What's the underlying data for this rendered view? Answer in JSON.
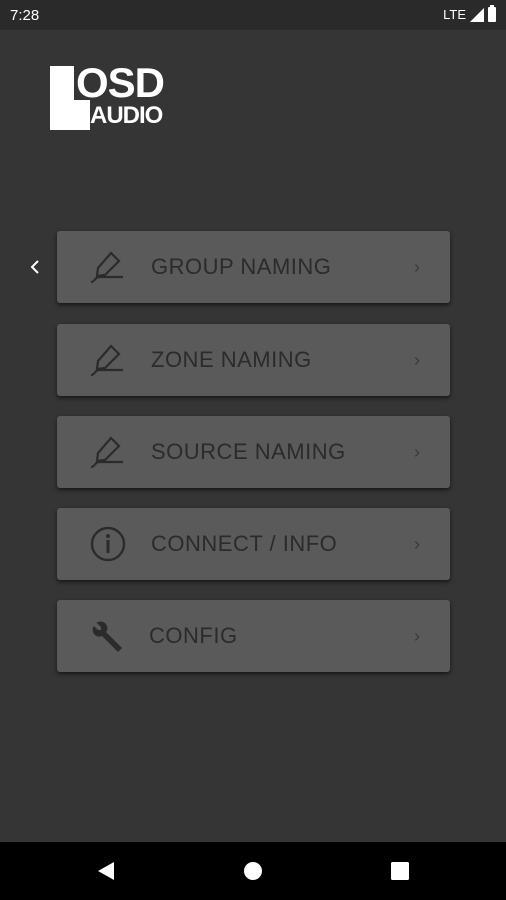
{
  "status_bar": {
    "time": "7:28",
    "network": "LTE"
  },
  "logo": {
    "line1": "OSD",
    "line2": "AUDIO"
  },
  "menu": [
    {
      "label": "GROUP NAMING",
      "icon": "pencil-icon"
    },
    {
      "label": "ZONE NAMING",
      "icon": "pencil-icon"
    },
    {
      "label": "SOURCE NAMING",
      "icon": "pencil-icon"
    },
    {
      "label": "CONNECT / INFO",
      "icon": "info-icon"
    },
    {
      "label": "CONFIG",
      "icon": "wrench-icon"
    }
  ],
  "colors": {
    "background": "#353535",
    "button": "#5a5a5a",
    "text": "#2b2b2b",
    "status_bar": "#2a2a2a"
  }
}
